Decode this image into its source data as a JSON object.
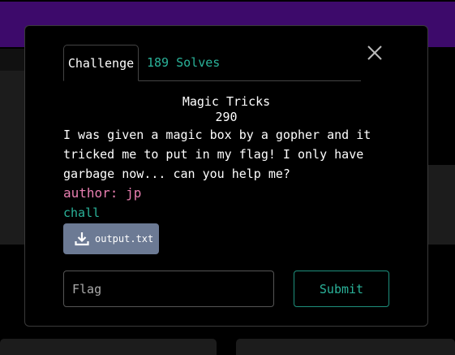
{
  "modal": {
    "tabs": [
      {
        "label": "Challenge"
      },
      {
        "label": "189 Solves"
      }
    ],
    "challenge": {
      "name": "Magic Tricks",
      "value": "290",
      "description": "I was given a magic box by a gopher and it tricked me to put in my flag! I only have garbage now... can you help me?",
      "author": "author: jp",
      "chall_link": "chall",
      "file_label": "output.txt"
    },
    "form": {
      "flag_placeholder": "Flag",
      "submit_label": "Submit"
    }
  },
  "colors": {
    "topbar": "#3d0a6b",
    "accent": "#2ab39a",
    "author": "#e97fb1",
    "download_button": "#6c7a94"
  }
}
